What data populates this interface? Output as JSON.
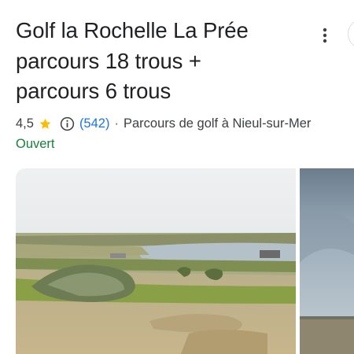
{
  "place": {
    "title_lines": [
      "Golf la Rochelle La Prée",
      "parcours 18 trous +",
      "parcours 6 trous"
    ],
    "rating": "4,5",
    "review_count": "(542)",
    "separator": "·",
    "category": "Parcours de golf à Nieul-sur-Mer",
    "status": "Ouvert"
  },
  "icons": {
    "more": "vertical-dots-icon",
    "star": "star-icon",
    "info": "info-icon"
  },
  "colors": {
    "title": "#202124",
    "link": "#1a73e8",
    "open_status": "#188038",
    "star": "#fbbc04"
  }
}
